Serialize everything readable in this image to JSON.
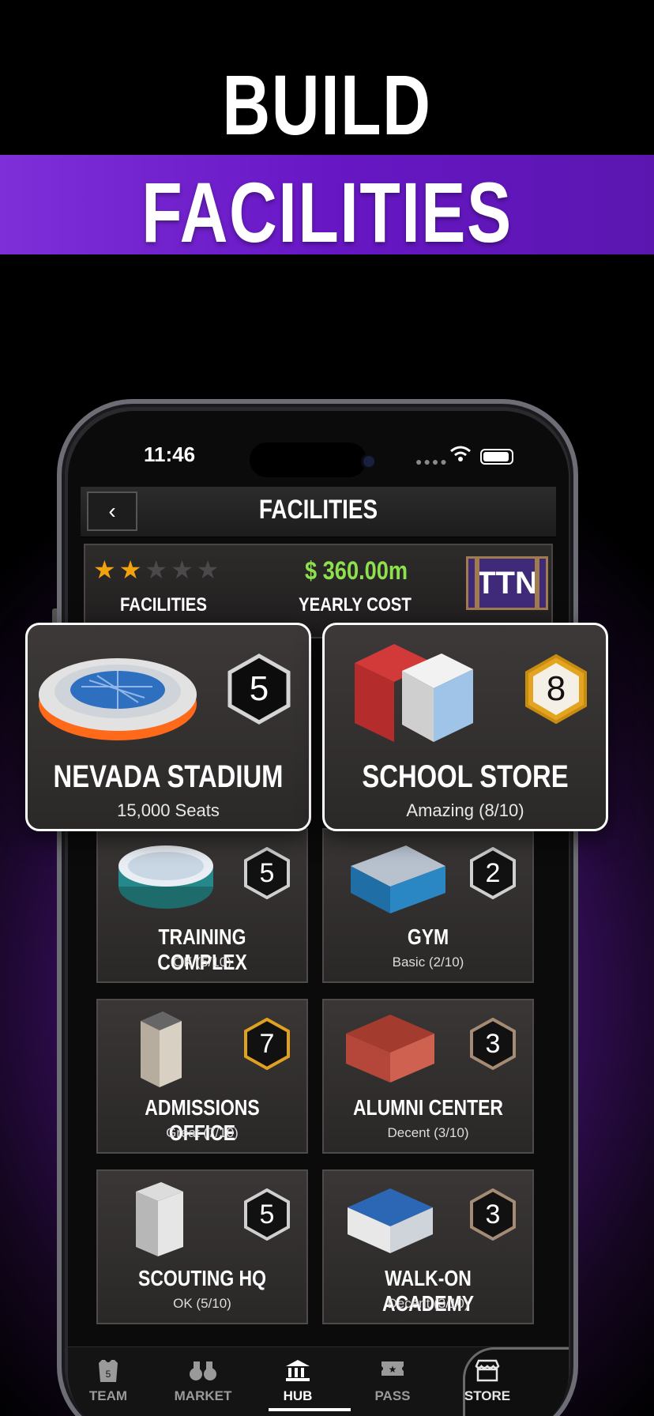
{
  "promo": {
    "line1": "BUILD",
    "line2": "FACILITIES"
  },
  "status_bar": {
    "time": "11:46"
  },
  "header": {
    "title": "FACILITIES",
    "back_icon": "chevron-left-icon"
  },
  "summary": {
    "stars_filled": 2,
    "stars_total": 5,
    "facilities_label": "FACILITIES",
    "cost": "$ 360.00m",
    "cost_label": "YEARLY COST",
    "team_badge": "TTN"
  },
  "featured": [
    {
      "name": "NEVADA STADIUM",
      "detail": "15,000 Seats",
      "level": "5",
      "level_color": "#ffffff",
      "ring": "#cfcfcf"
    },
    {
      "name": "SCHOOL STORE",
      "detail": "Amazing (8/10)",
      "level": "8",
      "level_color": "#111111",
      "ring": "#e0a020"
    }
  ],
  "facilities": [
    {
      "name": "TRAINING COMPLEX",
      "detail": "OK (5/10)",
      "level": "5",
      "ring": "#cfcfcf"
    },
    {
      "name": "GYM",
      "detail": "Basic (2/10)",
      "level": "2",
      "ring": "#cfcfcf"
    },
    {
      "name": "ADMISSIONS OFFICE",
      "detail": "Great (7/10)",
      "level": "7",
      "ring": "#e0a020"
    },
    {
      "name": "ALUMNI CENTER",
      "detail": "Decent (3/10)",
      "level": "3",
      "ring": "#a58a74"
    },
    {
      "name": "SCOUTING HQ",
      "detail": "OK (5/10)",
      "level": "5",
      "ring": "#cfcfcf"
    },
    {
      "name": "WALK-ON ACADEMY",
      "detail": "Decent (3/10)",
      "level": "3",
      "ring": "#a58a74"
    }
  ],
  "nav": [
    {
      "label": "TEAM",
      "icon": "jersey-icon"
    },
    {
      "label": "MARKET",
      "icon": "binoculars-icon"
    },
    {
      "label": "HUB",
      "icon": "building-icon",
      "active": true
    },
    {
      "label": "PASS",
      "icon": "ticket-icon"
    },
    {
      "label": "STORE",
      "icon": "store-icon"
    }
  ]
}
